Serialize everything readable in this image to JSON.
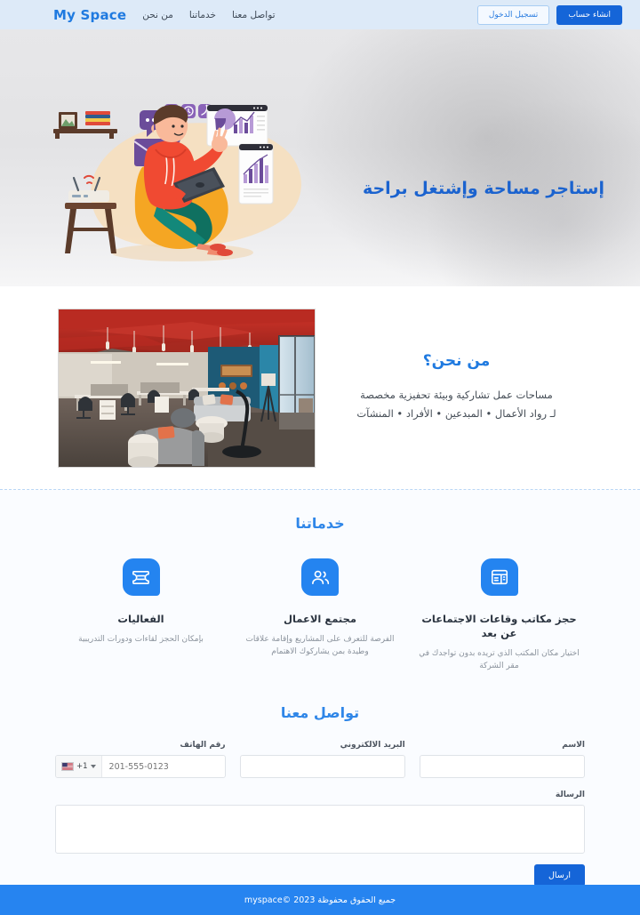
{
  "navbar": {
    "brand": "My Space",
    "links": [
      {
        "label": "من نحن"
      },
      {
        "label": "خدماتنا"
      },
      {
        "label": "تواصل معنا"
      }
    ],
    "login_label": "تسجيل الدخول",
    "signup_label": "انشاء حساب"
  },
  "hero": {
    "title": "إستاجر مساحة وإشتغل براحة",
    "illustration_alt": "person-on-beanbag-with-laptop-illustration"
  },
  "about": {
    "title": "من نحن؟",
    "line1": "مساحات عمل تشاركية وبيئة تحفيزية مخصصة",
    "line2": "لـ رواد الأعمال • المبدعين • الأفراد • المنشآت",
    "photo_alt": "open-plan-coworking-office-photo"
  },
  "services": {
    "title": "خدماتنا",
    "items": [
      {
        "icon": "ticket-icon",
        "name": "الفعاليات",
        "desc": "بإمكان الحجز لقاءات ودورات التدريبية"
      },
      {
        "icon": "people-icon",
        "name": "مجتمع الاعمال",
        "desc": "الفرصة للتعرف على المشاريع وإقامة علاقات وطيدة بمن يشاركوك الاهتمام"
      },
      {
        "icon": "desk-icon",
        "name": "حجز مكاتب وقاعات الاجتماعات عن بعد",
        "desc": "اختيار مكان المكتب الذي تريده بدون تواجدك في مقر الشركة"
      }
    ]
  },
  "contact": {
    "title": "تواصل معنا",
    "name_label": "الاسم",
    "name_value": "",
    "email_label": "البريد الالكتروني",
    "email_value": "",
    "phone_label": "رقم الهاتف",
    "phone_dial_code": "+1",
    "phone_flag": "us-flag-icon",
    "phone_placeholder": "201-555-0123",
    "phone_value": "",
    "message_label": "الرسالة",
    "message_value": "",
    "submit_label": "ارسال"
  },
  "footer": {
    "text": "جميع الحقوق محفوظة 2023 ©myspace"
  },
  "colors": {
    "primary": "#1565d8",
    "accent": "#2684f0",
    "nav_bg": "#ddeaf8",
    "heading": "#1b63cf"
  }
}
